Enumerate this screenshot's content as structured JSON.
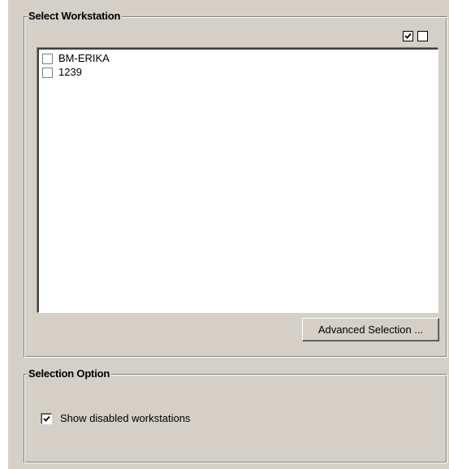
{
  "select_workstation": {
    "title": "Select Workstation",
    "check_all_icon": "checked-box-icon",
    "uncheck_all_icon": "empty-box-icon",
    "workstations": [
      {
        "label": "BM-ERIKA",
        "checked": false
      },
      {
        "label": "1239",
        "checked": false
      }
    ],
    "advanced_button_label": "Advanced Selection ..."
  },
  "selection_option": {
    "title": "Selection Option",
    "show_disabled_label": "Show disabled workstations",
    "show_disabled_checked": true
  },
  "colors": {
    "panel_bg": "#d4d0c8",
    "list_bg": "#ffffff",
    "text": "#000000"
  }
}
